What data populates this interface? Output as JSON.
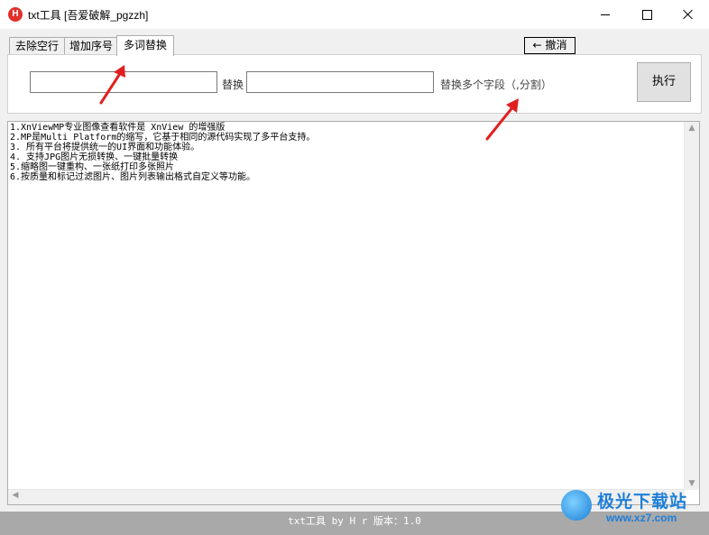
{
  "window": {
    "title": "txt工具 [吾爱破解_pgzzh]",
    "app_icon_letter": "H"
  },
  "tabs": [
    {
      "label": "去除空行",
      "active": false
    },
    {
      "label": "增加序号",
      "active": false
    },
    {
      "label": "多词替换",
      "active": true
    }
  ],
  "toolbar": {
    "undo_arrow": "←",
    "undo_label": "撤消"
  },
  "panel": {
    "find_value": "",
    "replace_label": "替换",
    "replace_value": "",
    "hint": "替换多个字段（,分割）",
    "execute_label": "执行"
  },
  "content": {
    "lines": [
      "1.XnViewMP专业图像查看软件是 XnView 的增强版",
      "2.MP是Multi Platform的缩写，它基于相同的源代码实现了多平台支持。",
      "3. 所有平台将提供统一的UI界面和功能体验。",
      "4. 支持JPG图片无损转换、一键批量转换",
      "5.缩略图一键重构、一张纸打印多张照片",
      "6.按质量和标记过滤图片、图片列表输出格式自定义等功能。"
    ]
  },
  "status": {
    "text": "txt工具 by H r  版本：1.0"
  },
  "watermark": {
    "title": "极光下载站",
    "url": "www.xz7.com"
  },
  "colors": {
    "accent_arrow": "#e02020",
    "watermark_blue": "#1e7fd8",
    "statusbar": "#a9a9a9"
  }
}
